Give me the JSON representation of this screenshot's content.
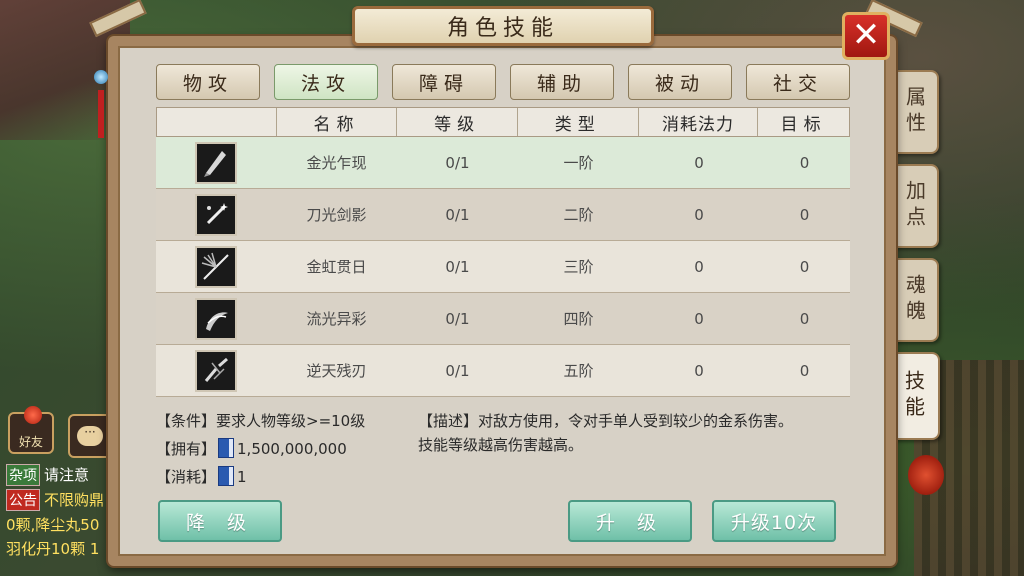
{
  "window": {
    "title": "角色技能",
    "close_label": "✕"
  },
  "side_tabs": [
    {
      "label": "属性",
      "active": false
    },
    {
      "label": "加点",
      "active": false
    },
    {
      "label": "魂魄",
      "active": false
    },
    {
      "label": "技能",
      "active": true
    }
  ],
  "category_tabs": [
    {
      "label": "物攻",
      "active": false
    },
    {
      "label": "法攻",
      "active": true
    },
    {
      "label": "障碍",
      "active": false
    },
    {
      "label": "辅助",
      "active": false
    },
    {
      "label": "被动",
      "active": false
    },
    {
      "label": "社交",
      "active": false
    }
  ],
  "table": {
    "headers": [
      "",
      "名称",
      "等级",
      "类型",
      "消耗法力",
      "目标"
    ],
    "rows": [
      {
        "icon": "blade-sweep-icon",
        "name": "金光乍现",
        "level": "0/1",
        "type": "一阶",
        "mana": "0",
        "target": "0",
        "selected": true
      },
      {
        "icon": "sparkle-sword-icon",
        "name": "刀光剑影",
        "level": "0/1",
        "type": "二阶",
        "mana": "0",
        "target": "0",
        "selected": false
      },
      {
        "icon": "radiant-sword-icon",
        "name": "金虹贯日",
        "level": "0/1",
        "type": "三阶",
        "mana": "0",
        "target": "0",
        "selected": false
      },
      {
        "icon": "spiral-blade-icon",
        "name": "流光异彩",
        "level": "0/1",
        "type": "四阶",
        "mana": "0",
        "target": "0",
        "selected": false
      },
      {
        "icon": "broken-blade-icon",
        "name": "逆天残刃",
        "level": "0/1",
        "type": "五阶",
        "mana": "0",
        "target": "0",
        "selected": false
      }
    ]
  },
  "details": {
    "condition": "【条件】要求人物等级>=10级",
    "own_prefix": "【拥有】",
    "own_value": "1,500,000,000",
    "cost_prefix": "【消耗】",
    "cost_value": "1",
    "description_line1": "【描述】对敌方使用，令对手单人受到较少的金系伤害。",
    "description_line2": "技能等级越高伤害越高。"
  },
  "buttons": {
    "downgrade": "降 级",
    "upgrade": "升 级",
    "upgrade10": "升级10次"
  },
  "hud": {
    "friend_label": "好友",
    "chat_icon_text": "···",
    "chat_lines": [
      {
        "tag": "杂项",
        "text": "请注意",
        "tag_color": "#3a7a3a",
        "text_color": "#ffffff"
      },
      {
        "tag": "公告",
        "text": "不限购鼎",
        "tag_color": "#c02a20",
        "text_color": "#ffe060"
      },
      {
        "tag": "",
        "text": "0颗,降尘丸50",
        "tag_color": "",
        "text_color": "#ffe060"
      },
      {
        "tag": "",
        "text": "羽化丹10颗 1",
        "tag_color": "",
        "text_color": "#ffe060"
      }
    ]
  },
  "colors": {
    "accent_green": "#6fc0a8",
    "panel_brown": "#a78561",
    "close_red": "#c02a20"
  }
}
